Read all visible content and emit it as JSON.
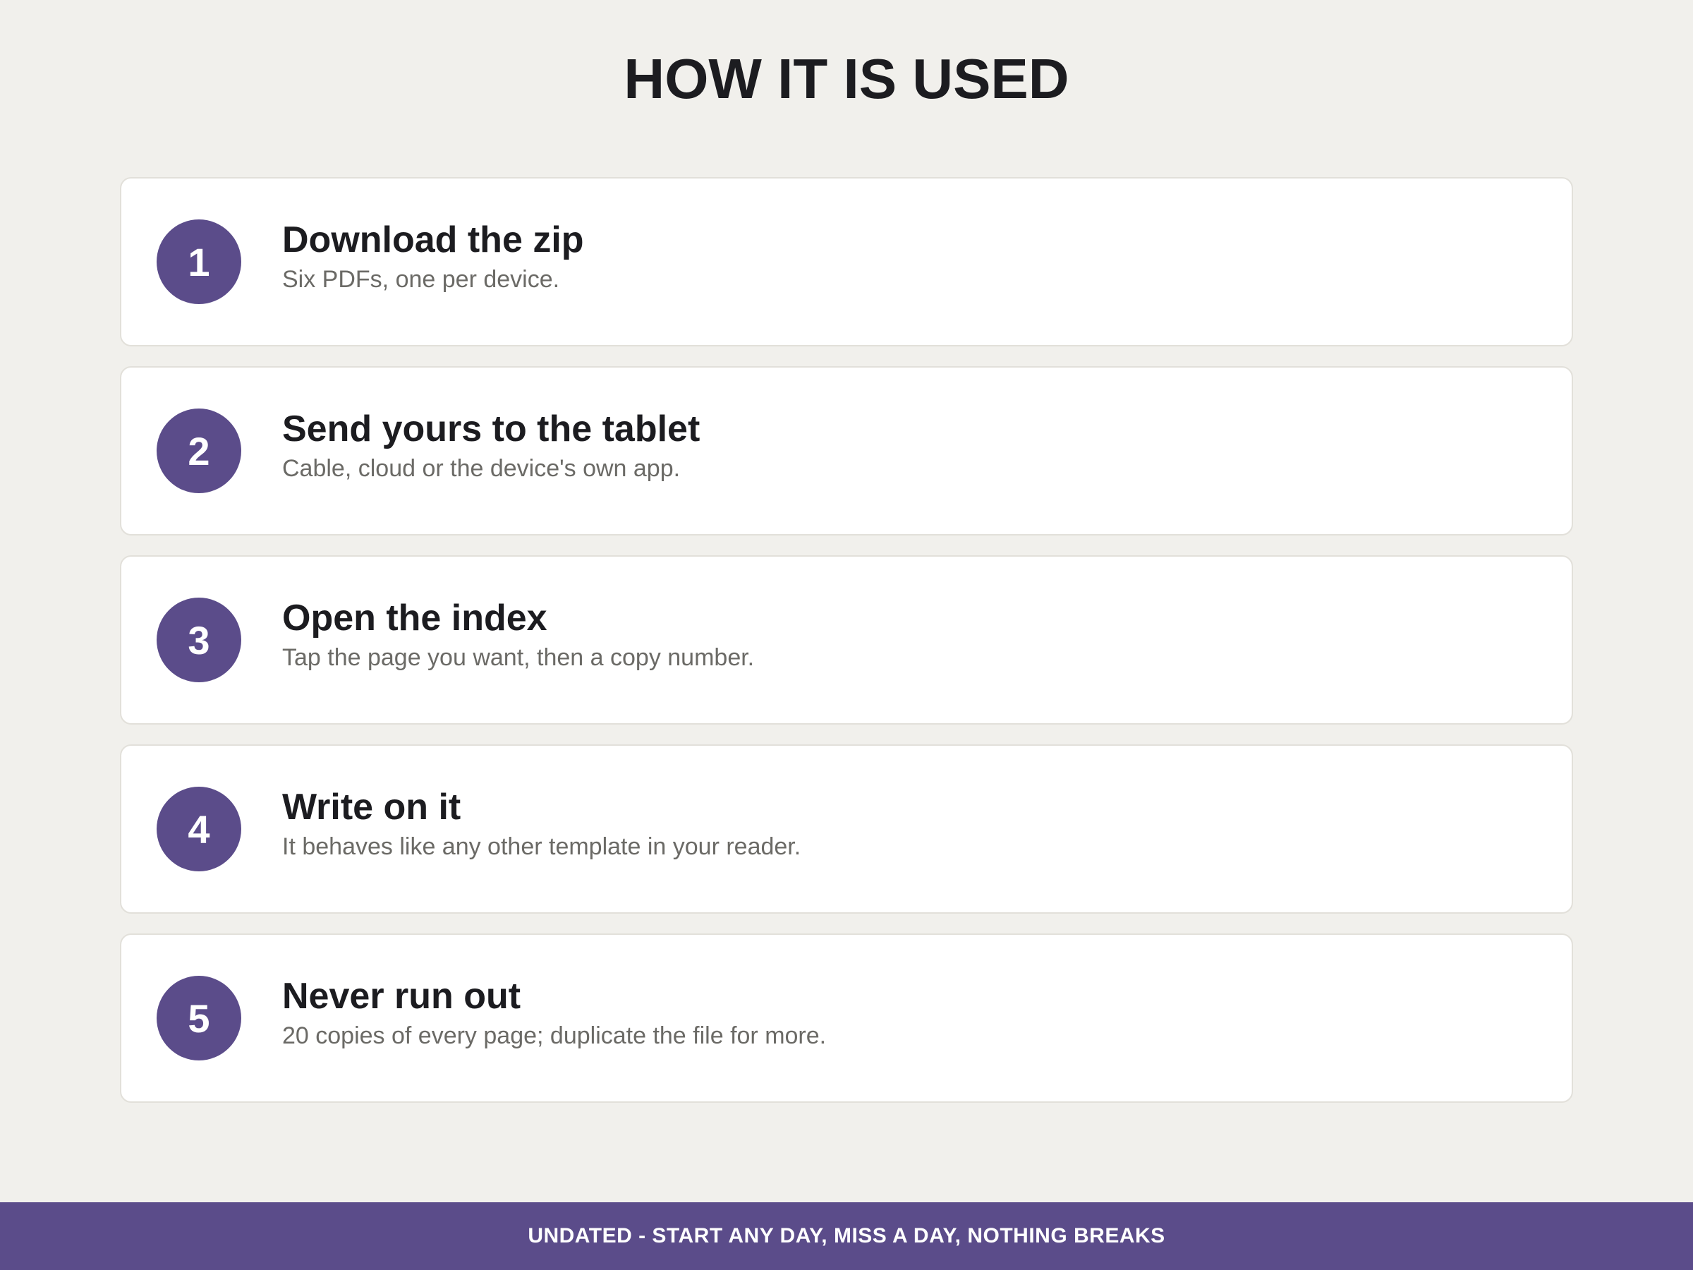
{
  "title": "HOW IT IS USED",
  "steps": [
    {
      "number": "1",
      "title": "Download the zip",
      "description": "Six PDFs, one per device."
    },
    {
      "number": "2",
      "title": "Send yours to the tablet",
      "description": "Cable, cloud or the device's own app."
    },
    {
      "number": "3",
      "title": "Open the index",
      "description": "Tap the page you want, then a copy number."
    },
    {
      "number": "4",
      "title": "Write on it",
      "description": "It behaves like any other template in your reader."
    },
    {
      "number": "5",
      "title": "Never run out",
      "description": "20 copies of every page; duplicate the file for more."
    }
  ],
  "footer": {
    "text": "UNDATED - START ANY DAY, MISS A DAY, NOTHING BREAKS"
  },
  "colors": {
    "accent": "#5b4c8a",
    "background": "#f1f0ec",
    "card": "#ffffff",
    "title_text": "#1c1c20",
    "description_text": "#6b6a66"
  }
}
